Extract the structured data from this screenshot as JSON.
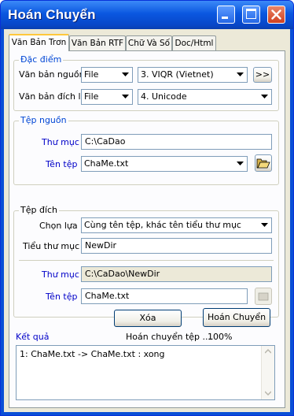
{
  "window": {
    "title": "Hoán Chuyển"
  },
  "tabs": [
    {
      "label": "Văn Bản Trơn"
    },
    {
      "label": "Văn Bản RTF"
    },
    {
      "label": "Chữ Và Số"
    },
    {
      "label": "Doc/Html"
    }
  ],
  "features": {
    "legend": "Đặc điểm",
    "source_label": "Văn bản nguồn",
    "source_type": "File",
    "source_encoding": "3. VIQR (Vietnet)",
    "more_button": ">>",
    "target_label": "Văn bản đích là",
    "target_type": "File",
    "target_encoding": "4. Unicode"
  },
  "source_file": {
    "legend": "Tệp nguồn",
    "dir_label": "Thư mục",
    "dir_value": "C:\\CaDao",
    "file_label": "Tên tệp",
    "file_value": "ChaMe.txt"
  },
  "target_file": {
    "legend": "Tệp đích",
    "choice_label": "Chọn lựa",
    "choice_value": "Cùng tên tệp, khác tên tiểu thư mục",
    "subdir_label": "Tiểu thư mục",
    "subdir_value": "NewDir",
    "dir_label": "Thư mục",
    "dir_value": "C:\\CaDao\\NewDir",
    "file_label": "Tên tệp",
    "file_value": "ChaMe.txt"
  },
  "actions": {
    "clear": "Xóa",
    "convert": "Hoán Chuyển"
  },
  "result": {
    "label": "Kết quả",
    "status_text": "Hoán chuyển tệp ....",
    "progress": "100%",
    "log": [
      "1: ChaMe.txt -> ChaMe.txt : xong"
    ]
  }
}
